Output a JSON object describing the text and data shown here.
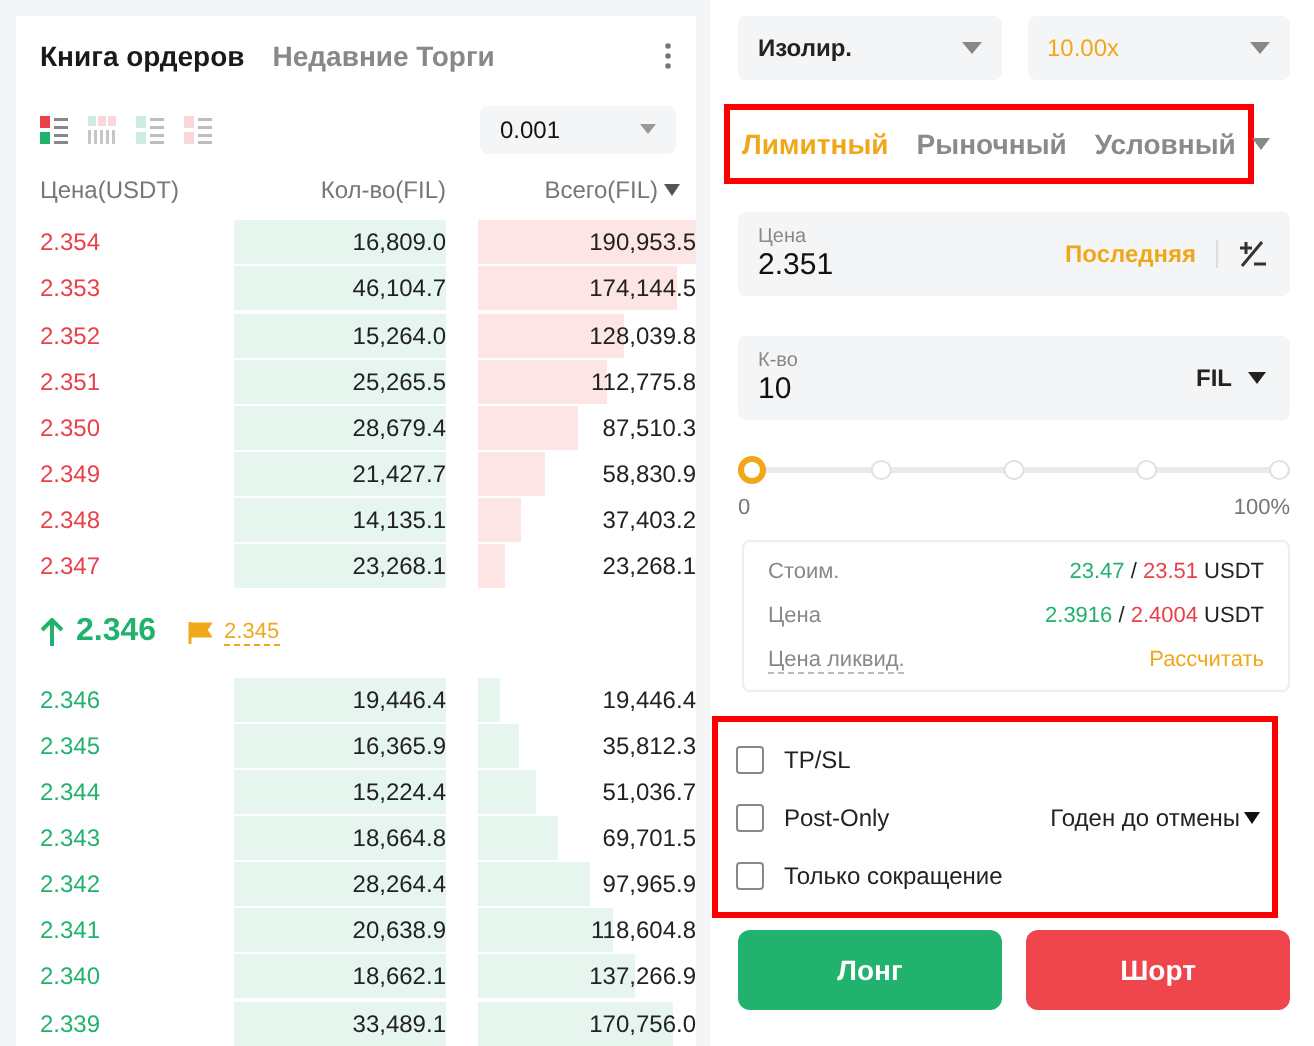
{
  "order_book": {
    "tabs": [
      {
        "label": "Книга ордеров",
        "selected": true
      },
      {
        "label": "Недавние Торги",
        "selected": false
      }
    ],
    "view_modes": [
      {
        "kind": "both",
        "selected": true
      },
      {
        "kind": "columns",
        "selected": false
      },
      {
        "kind": "bids",
        "selected": false
      },
      {
        "kind": "asks",
        "selected": false
      }
    ],
    "precision": "0.001",
    "columns": [
      "Цена(USDT)",
      "Кол-во(FIL)",
      "Всего(FIL)"
    ],
    "asks": [
      {
        "price": "2.354",
        "qty": "16,809.0",
        "total": "190,953.5"
      },
      {
        "price": "2.353",
        "qty": "46,104.7",
        "total": "174,144.5"
      },
      {
        "price": "2.352",
        "qty": "15,264.0",
        "total": "128,039.8"
      },
      {
        "price": "2.351",
        "qty": "25,265.5",
        "total": "112,775.8"
      },
      {
        "price": "2.350",
        "qty": "28,679.4",
        "total": "87,510.3"
      },
      {
        "price": "2.349",
        "qty": "21,427.7",
        "total": "58,830.9"
      },
      {
        "price": "2.348",
        "qty": "14,135.1",
        "total": "37,403.2"
      },
      {
        "price": "2.347",
        "qty": "23,268.1",
        "total": "23,268.1"
      }
    ],
    "last_price": "2.346",
    "mark_price": "2.345",
    "bids": [
      {
        "price": "2.346",
        "qty": "19,446.4",
        "total": "19,446.4"
      },
      {
        "price": "2.345",
        "qty": "16,365.9",
        "total": "35,812.3"
      },
      {
        "price": "2.344",
        "qty": "15,224.4",
        "total": "51,036.7"
      },
      {
        "price": "2.343",
        "qty": "18,664.8",
        "total": "69,701.5"
      },
      {
        "price": "2.342",
        "qty": "28,264.4",
        "total": "97,965.9"
      },
      {
        "price": "2.341",
        "qty": "20,638.9",
        "total": "118,604.8"
      },
      {
        "price": "2.340",
        "qty": "18,662.1",
        "total": "137,266.9"
      },
      {
        "price": "2.339",
        "qty": "33,489.1",
        "total": "170,756.0"
      }
    ]
  },
  "order_form": {
    "margin_mode": "Изолир.",
    "leverage": "10.00x",
    "order_types": {
      "highlighted": true,
      "tabs": [
        {
          "label": "Лимитный",
          "selected": true,
          "has_menu": false
        },
        {
          "label": "Рыночный",
          "selected": false,
          "has_menu": false
        },
        {
          "label": "Условный",
          "selected": false,
          "has_menu": true
        }
      ]
    },
    "price_field": {
      "label": "Цена",
      "value": "2.351",
      "action": "Последняя"
    },
    "qty_field": {
      "label": "К-во",
      "value": "10",
      "unit": "FIL"
    },
    "slider": {
      "level": 0,
      "min_label": "0",
      "max_label": "100%"
    },
    "info": [
      {
        "label": "Стоим.",
        "buy": "23.47",
        "separator": "/",
        "sell": "23.51",
        "unit": "USDT",
        "kind": "pair"
      },
      {
        "label": "Цена",
        "buy": "2.3916",
        "separator": "/",
        "sell": "2.4004",
        "unit": "USDT",
        "kind": "pair"
      },
      {
        "label": "Цена ликвид.",
        "action": "Рассчитать",
        "kind": "action"
      }
    ],
    "options": {
      "highlighted": true,
      "items": [
        {
          "label": "TP/SL",
          "checked": false
        },
        {
          "label": "Post-Only",
          "checked": false,
          "extra": "Годен до отмены"
        },
        {
          "label": "Только сокращение",
          "checked": false
        }
      ]
    },
    "buttons": [
      {
        "label": "Лонг",
        "kind": "buy"
      },
      {
        "label": "Шорт",
        "kind": "sell"
      }
    ]
  }
}
